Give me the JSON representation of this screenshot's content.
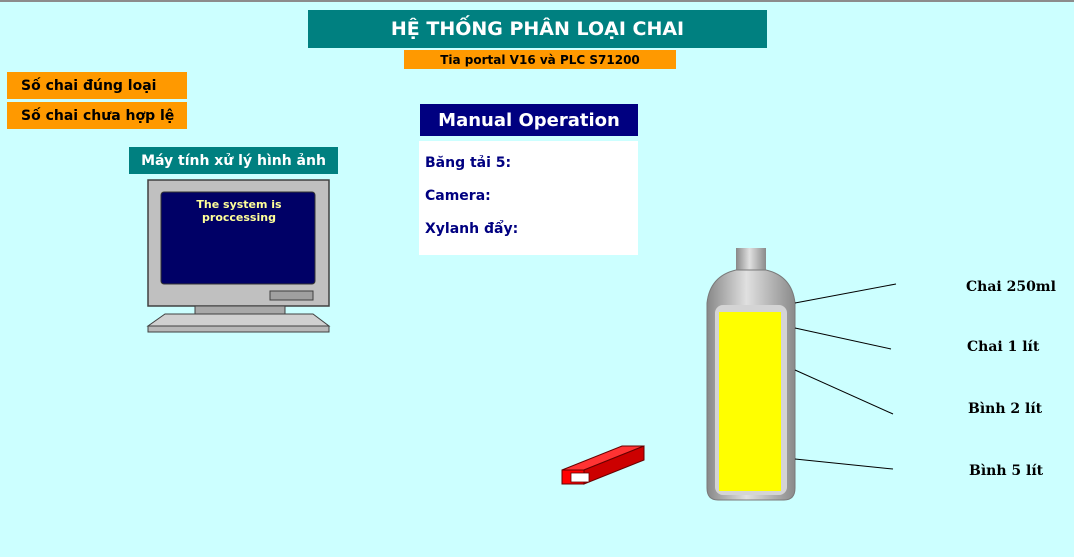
{
  "header": {
    "title": "HỆ THỐNG PHÂN LOẠI CHAI",
    "subtitle": "Tia portal V16 và PLC S71200"
  },
  "counters": {
    "correct_label": "Số chai đúng loại",
    "invalid_label": "Số chai chưa hợp lệ"
  },
  "pc": {
    "label": "Máy tính xử lý hình ảnh",
    "screen_text": "The system is proccessing"
  },
  "manual": {
    "title": "Manual Operation",
    "rows": [
      "Băng tải 5:",
      "Camera:",
      "Xylanh đẩy:"
    ]
  },
  "bottle": {
    "labels": [
      "Chai 250ml",
      "Chai 1 lít",
      "Bình 2 lít",
      "Bình 5 lít"
    ]
  },
  "colors": {
    "background": "#ccffff",
    "teal": "#008080",
    "orange": "#ff9900",
    "navy": "#000080",
    "liquid": "#ffff00",
    "box": "#ff0000"
  }
}
